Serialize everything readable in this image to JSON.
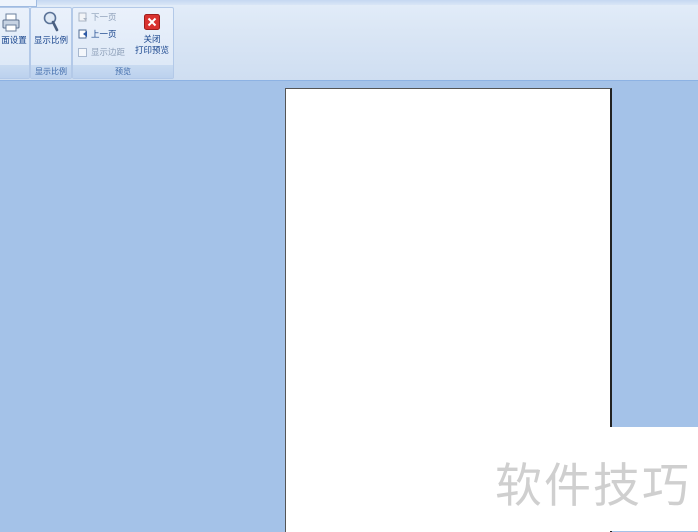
{
  "ribbon": {
    "page_setup_label": "面设置",
    "zoom_group": {
      "button_label": "显示比例",
      "group_label": "显示比例"
    },
    "preview_group": {
      "group_label": "预览",
      "next_page_label": "下一页",
      "prev_page_label": "上一页",
      "show_margins_label": "显示边距",
      "show_margins_checked": false,
      "close_label_line1": "关闭",
      "close_label_line2": "打印预览"
    }
  },
  "watermark_text": "软件技巧",
  "colors": {
    "workspace": "#a4c2e8",
    "page": "#ffffff",
    "close_icon": "#d9322f"
  }
}
